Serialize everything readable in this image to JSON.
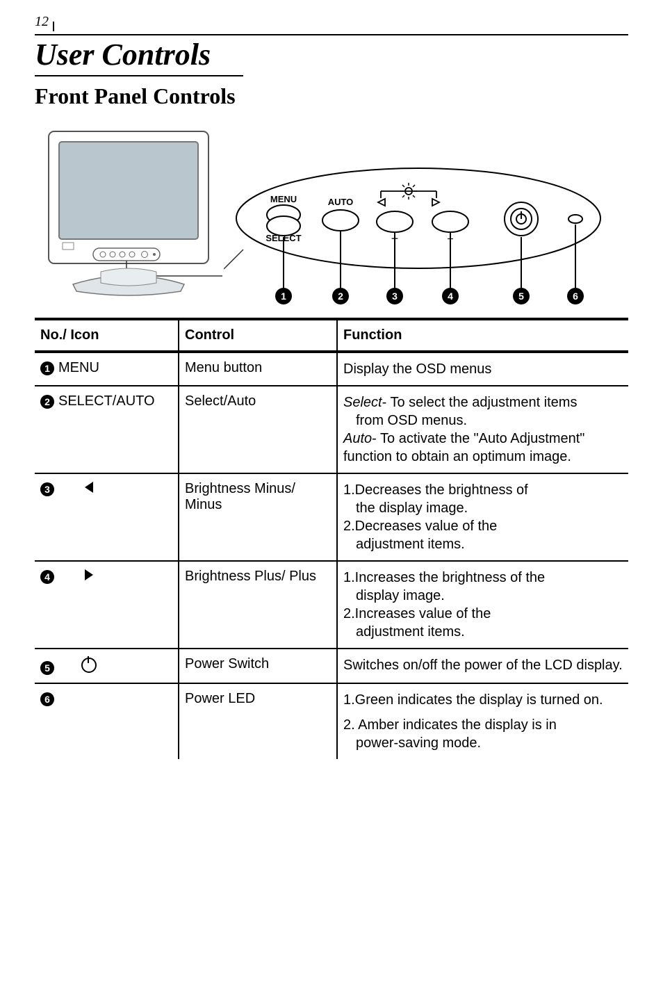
{
  "page_number": "12",
  "title": "User Controls",
  "subtitle": "Front Panel Controls",
  "panel_labels": {
    "menu": "MENU",
    "select": "SELECT",
    "auto": "AUTO",
    "minus": "−",
    "plus": "+"
  },
  "callout_numbers": [
    "1",
    "2",
    "3",
    "4",
    "5",
    "6"
  ],
  "table": {
    "headers": {
      "noicon": "No./ Icon",
      "control": "Control",
      "function": "Function"
    },
    "rows": [
      {
        "num": "1",
        "icon_label": "MENU",
        "icon_kind": "text",
        "control": "Menu button",
        "function_lines": [
          {
            "t": "Display the OSD menus"
          }
        ]
      },
      {
        "num": "2",
        "icon_label": "SELECT/AUTO",
        "icon_kind": "text",
        "control": "Select/Auto",
        "function_lines": [
          {
            "i": "Select",
            "t": "- To select the adjustment items"
          },
          {
            "indent": true,
            "t": "from OSD menus."
          },
          {
            "i": "Auto",
            "t": "- To activate the \"Auto Adjustment\""
          },
          {
            "t": "function to obtain an optimum image."
          }
        ]
      },
      {
        "num": "3",
        "icon_kind": "tri-left",
        "control": "Brightness Minus/ Minus",
        "function_lines": [
          {
            "t": "1.Decreases the brightness of"
          },
          {
            "indent": true,
            "t": "the display image."
          },
          {
            "t": "2.Decreases value of the"
          },
          {
            "indent": true,
            "t": "adjustment items."
          }
        ]
      },
      {
        "num": "4",
        "icon_kind": "tri-right",
        "control": "Brightness Plus/ Plus",
        "function_lines": [
          {
            "t": "1.Increases the brightness of the"
          },
          {
            "indent": true,
            "t": "display image."
          },
          {
            "t": "2.Increases value of the"
          },
          {
            "indent": true,
            "t": "adjustment items."
          }
        ]
      },
      {
        "num": "5",
        "icon_kind": "power",
        "control": "Power Switch",
        "function_lines": [
          {
            "t": "Switches on/off the power of the LCD display."
          }
        ]
      },
      {
        "num": "6",
        "icon_kind": "none",
        "control": "Power LED",
        "function_lines": [
          {
            "t": "1.Green indicates the display is turned on."
          },
          {
            "gap": true
          },
          {
            "t": "2. Amber indicates the display is in"
          },
          {
            "indent": true,
            "t": "power-saving mode."
          }
        ],
        "no_bottom": true
      }
    ]
  }
}
